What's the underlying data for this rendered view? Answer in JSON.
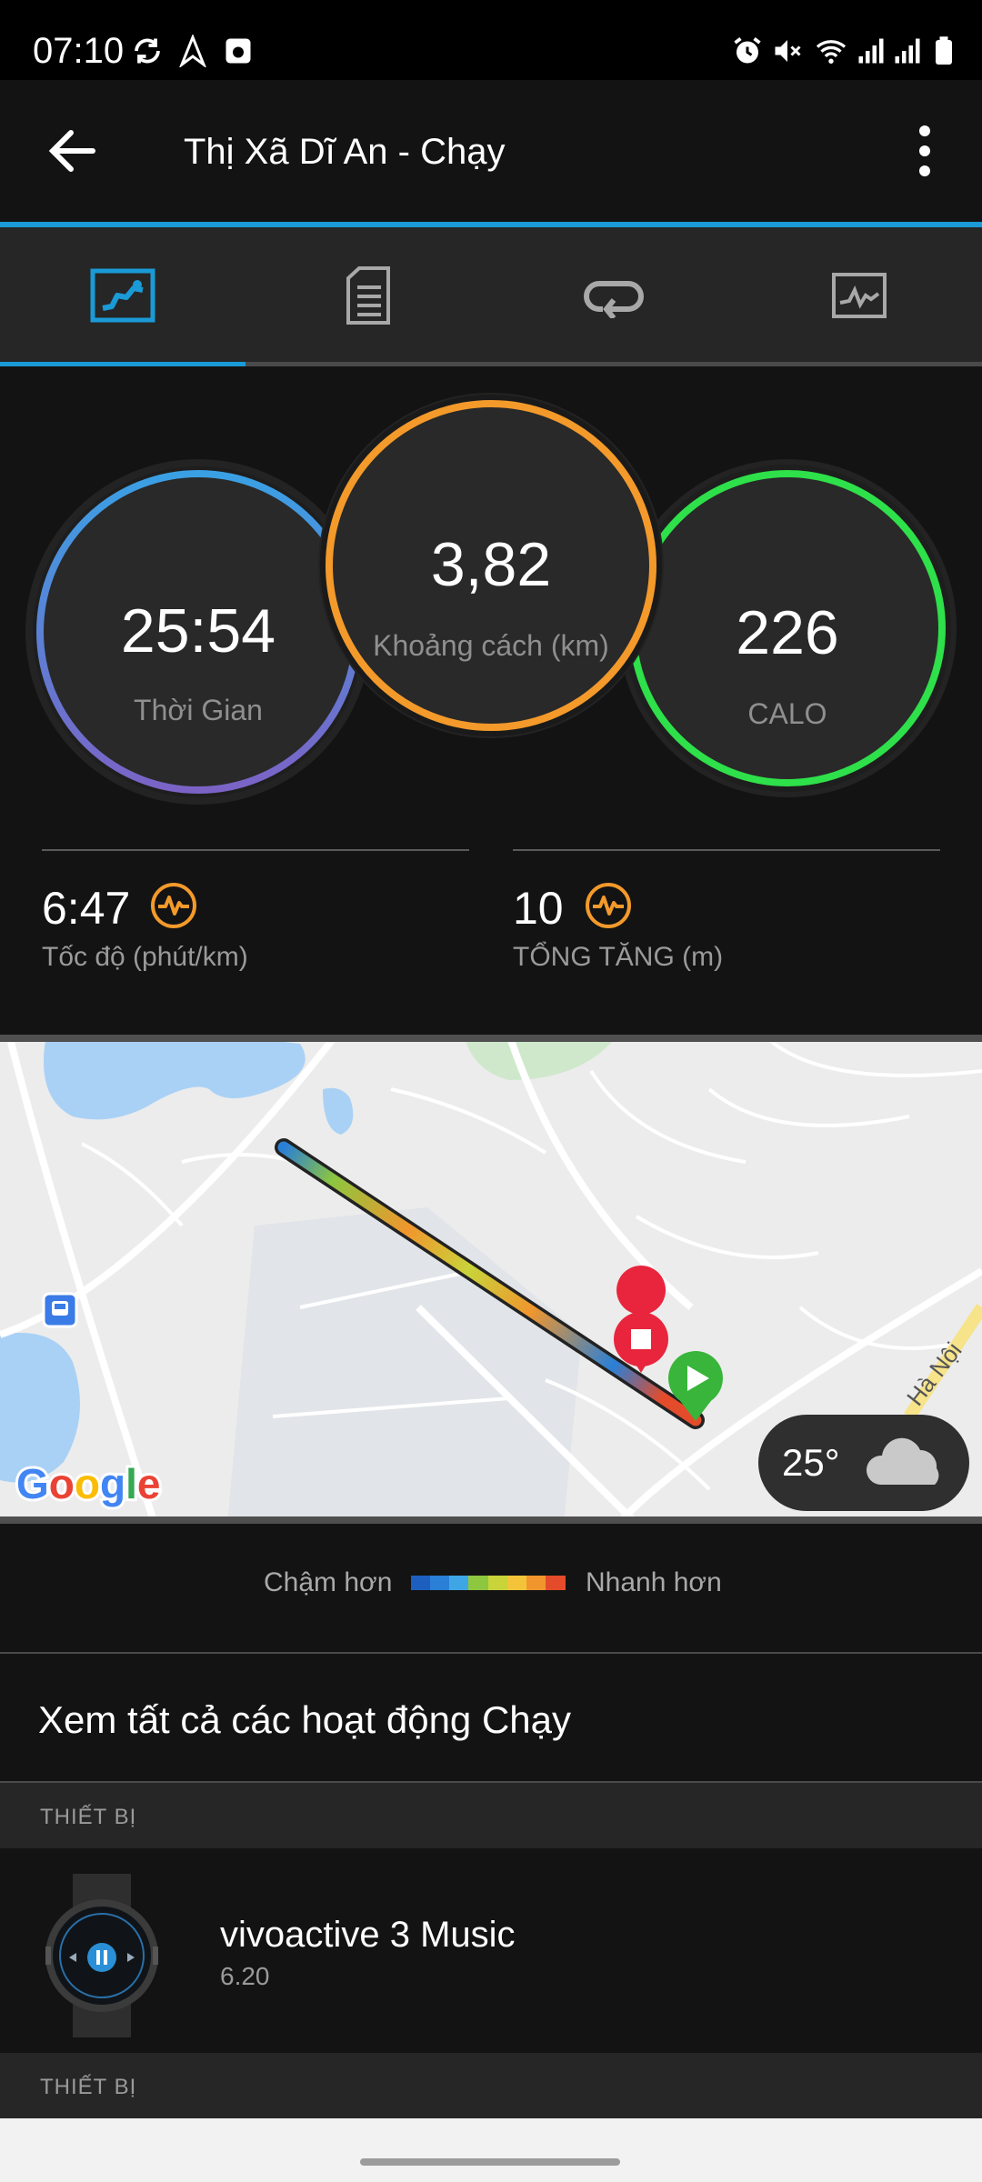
{
  "status": {
    "time": "07:10",
    "icons": [
      "sync-icon",
      "navigation-icon",
      "screenshot-icon",
      "alarm-icon",
      "mute-icon",
      "wifi-icon",
      "signal-icon",
      "signal-icon",
      "battery-icon"
    ]
  },
  "header": {
    "title": "Thị Xã Dĩ An - Chạy"
  },
  "tabs": [
    {
      "name": "overview",
      "icon": "run-overview-icon",
      "active": true
    },
    {
      "name": "details",
      "icon": "document-icon",
      "active": false
    },
    {
      "name": "laps",
      "icon": "laps-icon",
      "active": false
    },
    {
      "name": "charts",
      "icon": "chart-icon",
      "active": false
    }
  ],
  "summary": {
    "time": {
      "value": "25:54",
      "label": "Thời Gian"
    },
    "distance": {
      "value": "3,82",
      "label": "Khoảng cách (km)"
    },
    "calories": {
      "value": "226",
      "label": "CALO"
    }
  },
  "stats": {
    "pace": {
      "value": "6:47",
      "label": "Tốc độ (phút/km)"
    },
    "elevation": {
      "value": "10",
      "label": "TỔNG TĂNG (m)"
    }
  },
  "map": {
    "provider": "Google",
    "street_label": "Hà Nội",
    "weather": {
      "temp": "25°"
    }
  },
  "legend": {
    "slow": "Chậm hơn",
    "fast": "Nhanh hơn",
    "colors": [
      "#1d5fbf",
      "#2a7fd6",
      "#3fa6e6",
      "#8dc63f",
      "#c9d33a",
      "#f3c43a",
      "#f0962d",
      "#e44b2b"
    ]
  },
  "list": {
    "view_all": "Xem tất cả các hoạt động Chạy",
    "section_device": "THIẾT BỊ",
    "device": {
      "name": "vivoactive 3 Music",
      "version": "6.20"
    },
    "section_device_2": "THIẾT BỊ"
  },
  "colors": {
    "accent": "#1a9ad6",
    "time_ring": [
      "#3aa0e4",
      "#7b63c6"
    ],
    "distance_ring": "#f39a2b",
    "calorie_ring": "#2ee04a"
  }
}
